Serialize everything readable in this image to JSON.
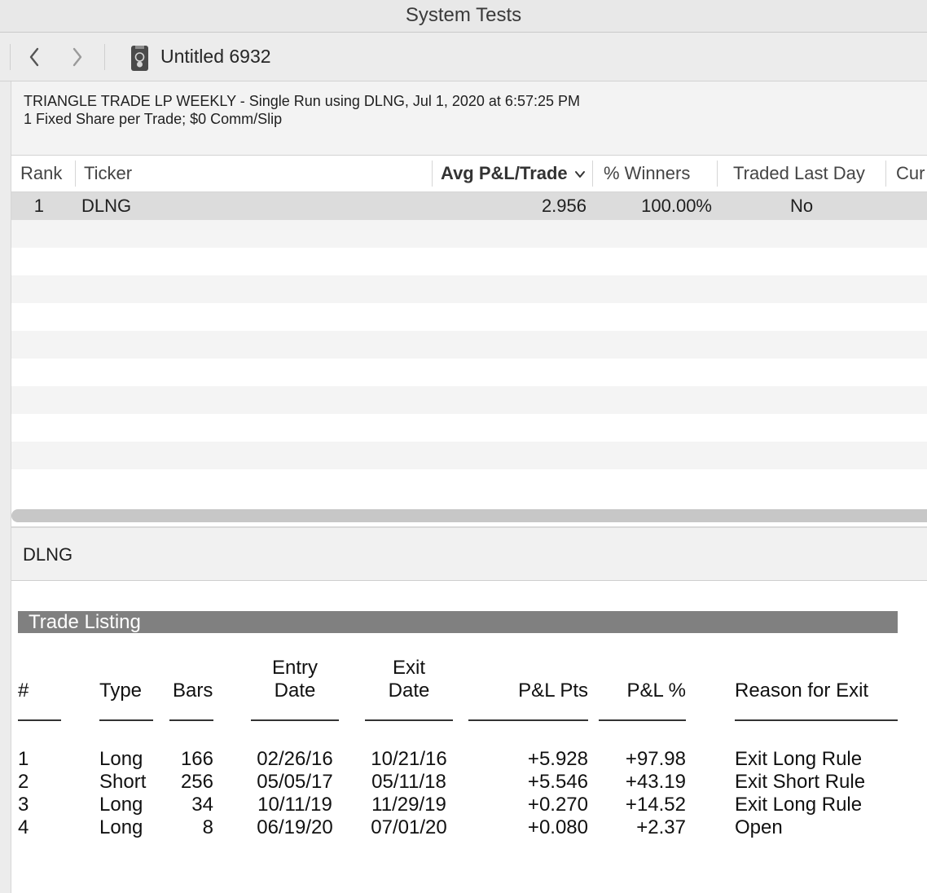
{
  "window": {
    "title": "System Tests"
  },
  "toolbar": {
    "back_icon": "chevron-left-icon",
    "forward_icon": "chevron-right-icon",
    "document_icon": "document-icon",
    "document_title": "Untitled 6932"
  },
  "info": {
    "line1": "TRIANGLE TRADE LP WEEKLY - Single Run using DLNG, Jul 1, 2020 at 6:57:25 PM",
    "line2": "1 Fixed Share per Trade; $0 Comm/Slip"
  },
  "results_table": {
    "columns": [
      "Rank",
      "Ticker",
      "Avg P&L/Trade",
      "% Winners",
      "Traded Last Day",
      "Cur"
    ],
    "sort_icon": "chevron-down-icon",
    "rows": [
      {
        "rank": "1",
        "ticker": "DLNG",
        "avg_pl": "2.956",
        "winners": "100.00%",
        "traded_last_day": "No"
      }
    ]
  },
  "detail": {
    "ticker": "DLNG"
  },
  "report": {
    "section_title": "Trade Listing",
    "headers": {
      "num": "#",
      "type": "Type",
      "bars": "Bars",
      "entry_1": "Entry",
      "entry_2": "Date",
      "exit_1": "Exit",
      "exit_2": "Date",
      "pl_pts": "P&L Pts",
      "pl_pct": "P&L %",
      "reason": "Reason for Exit"
    },
    "trades": [
      {
        "num": "1",
        "type": "Long",
        "bars": "166",
        "entry": "02/26/16",
        "exit": "10/21/16",
        "pl_pts": "+5.928",
        "pl_pct": "+97.98",
        "reason": "Exit Long Rule"
      },
      {
        "num": "2",
        "type": "Short",
        "bars": "256",
        "entry": "05/05/17",
        "exit": "05/11/18",
        "pl_pts": "+5.546",
        "pl_pct": "+43.19",
        "reason": "Exit Short Rule"
      },
      {
        "num": "3",
        "type": "Long",
        "bars": "34",
        "entry": "10/11/19",
        "exit": "11/29/19",
        "pl_pts": "+0.270",
        "pl_pct": "+14.52",
        "reason": "Exit Long Rule"
      },
      {
        "num": "4",
        "type": "Long",
        "bars": "8",
        "entry": "06/19/20",
        "exit": "07/01/20",
        "pl_pts": "+0.080",
        "pl_pct": "+2.37",
        "reason": "Open"
      }
    ]
  }
}
